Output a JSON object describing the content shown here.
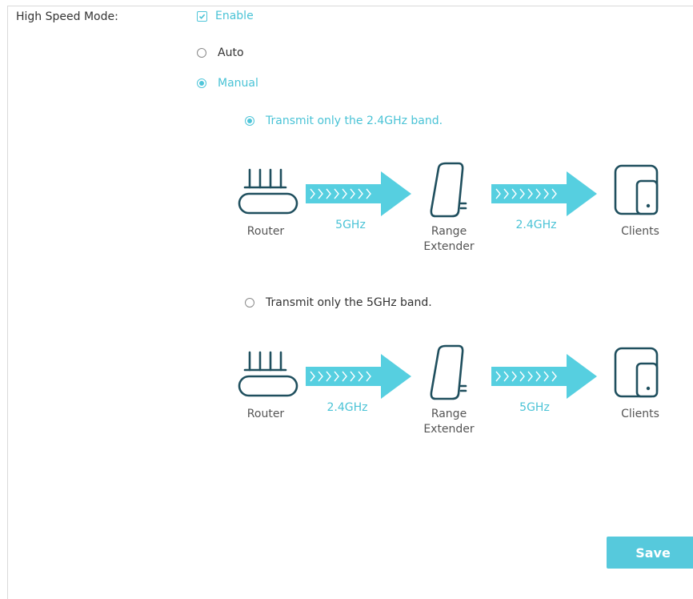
{
  "high_speed_mode": {
    "label": "High Speed Mode:",
    "enable_label": "Enable",
    "enabled": true
  },
  "mode": {
    "auto_label": "Auto",
    "manual_label": "Manual",
    "selected": "manual"
  },
  "band_options": [
    {
      "label": "Transmit only the 2.4GHz band.",
      "selected": true,
      "diagram": {
        "router_label": "Router",
        "first_band": "5GHz",
        "extender_label_line1": "Range",
        "extender_label_line2": "Extender",
        "second_band": "2.4GHz",
        "clients_label": "Clients"
      }
    },
    {
      "label": "Transmit only the 5GHz band.",
      "selected": false,
      "diagram": {
        "router_label": "Router",
        "first_band": "2.4GHz",
        "extender_label_line1": "Range",
        "extender_label_line2": "Extender",
        "second_band": "5GHz",
        "clients_label": "Clients"
      }
    }
  ],
  "save_label": "Save",
  "colors": {
    "accent": "#4ac3d6",
    "arrow": "#56cfe0",
    "icon_stroke": "#1f4f5e",
    "button": "#56c9dc"
  },
  "icons": [
    "check-icon",
    "router-icon",
    "range-extender-icon",
    "clients-icon",
    "arrow-icon"
  ]
}
